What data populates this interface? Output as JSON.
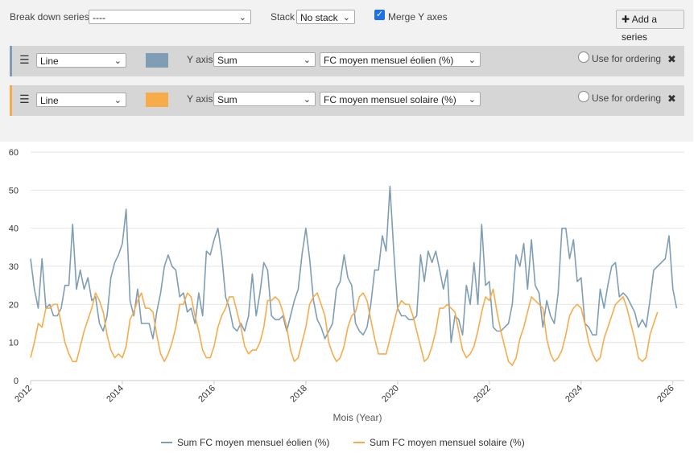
{
  "controls": {
    "breakdown_label": "Break down series",
    "breakdown_value": "----",
    "stack_label": "Stack",
    "stack_value": "No stack",
    "merge_label": "Merge Y axes",
    "add_series_label": "Add a series"
  },
  "series_rows": [
    {
      "type": "Line",
      "color": "#7f9db4",
      "yaxis_label": "Y axis",
      "agg": "Sum",
      "field": "FC moyen mensuel éolien (%)",
      "ordering_label": "Use for ordering"
    },
    {
      "type": "Line",
      "color": "#f7ac4c",
      "yaxis_label": "Y axis",
      "agg": "Sum",
      "field": "FC moyen mensuel solaire (%)",
      "ordering_label": "Use for ordering"
    }
  ],
  "chart_data": {
    "type": "line",
    "xlabel": "Mois (Year)",
    "ylabel": "",
    "x_ticks": [
      "2012",
      "2014",
      "2016",
      "2018",
      "2020",
      "2022",
      "2024",
      "2026"
    ],
    "y_ticks": [
      "0",
      "10",
      "20",
      "30",
      "40",
      "50",
      "60"
    ],
    "xlim": [
      2012,
      2026.25
    ],
    "ylim": [
      0,
      60
    ],
    "grid": true,
    "legend_position": "bottom",
    "series": [
      {
        "name": "Sum FC moyen mensuel éolien (%)",
        "color": "#7f9db4",
        "start": "2012-01",
        "step": "month",
        "values": [
          32,
          24,
          19,
          32,
          19,
          20,
          17,
          17,
          19,
          25,
          25,
          41,
          24,
          29,
          24,
          27,
          21,
          22,
          15,
          13,
          17,
          27,
          31,
          33,
          36,
          45,
          21,
          17,
          24,
          15,
          15,
          15,
          11,
          18,
          23,
          30,
          33,
          30,
          29,
          22,
          23,
          18,
          19,
          15,
          23,
          17,
          34,
          33,
          37,
          40,
          33,
          22,
          19,
          14,
          13,
          15,
          13,
          17,
          28,
          17,
          23,
          31,
          29,
          17,
          16,
          16,
          17,
          13,
          17,
          21,
          24,
          33,
          40,
          32,
          21,
          16,
          14,
          11,
          13,
          15,
          24,
          26,
          33,
          27,
          25,
          15,
          13,
          12,
          14,
          20,
          29,
          29,
          38,
          34,
          51,
          34,
          19,
          17,
          17,
          16,
          16,
          17,
          33,
          26,
          34,
          31,
          34,
          29,
          24,
          29,
          10,
          17,
          16,
          12,
          25,
          20,
          31,
          20,
          41,
          25,
          26,
          14,
          13,
          13,
          14,
          15,
          20,
          33,
          30,
          36,
          24,
          37,
          25,
          23,
          14,
          21,
          17,
          15,
          23,
          40,
          40,
          32,
          37,
          26,
          27,
          15,
          14,
          12,
          12,
          24,
          19,
          25,
          30,
          31,
          22,
          23,
          22,
          20,
          18,
          14,
          16,
          14,
          21,
          29,
          30,
          31,
          32,
          38,
          24,
          19
        ],
        "avg_values": []
      },
      {
        "name": "Sum FC moyen mensuel solaire (%)",
        "color": "#f7ac4c",
        "start": "2012-01",
        "step": "month",
        "values": [
          6,
          10,
          15,
          14,
          19,
          19,
          20,
          20,
          15,
          10,
          7,
          5,
          5,
          9,
          13,
          16,
          19,
          23,
          21,
          18,
          12,
          8,
          6,
          7,
          6,
          9,
          16,
          18,
          21,
          23,
          19,
          19,
          18,
          12,
          7,
          5,
          7,
          10,
          14,
          20,
          20,
          23,
          22,
          17,
          13,
          8,
          6,
          6,
          9,
          14,
          17,
          19,
          22,
          22,
          18,
          14,
          9,
          7,
          8,
          8,
          10,
          14,
          21,
          21,
          22,
          21,
          18,
          14,
          8,
          5,
          6,
          10,
          14,
          20,
          22,
          23,
          20,
          17,
          10,
          7,
          5,
          6,
          9,
          14,
          17,
          18,
          22,
          23,
          21,
          16,
          11,
          7,
          7,
          7,
          11,
          15,
          19,
          21,
          20,
          20,
          17,
          13,
          9,
          5,
          6,
          9,
          13,
          19,
          19,
          20,
          19,
          18,
          13,
          8,
          6,
          7,
          9,
          13,
          18,
          22,
          21,
          24,
          18,
          13,
          9,
          5,
          4,
          6,
          11,
          14,
          18,
          22,
          21,
          20,
          19,
          11,
          7,
          5,
          6,
          8,
          12,
          17,
          19,
          20,
          19,
          15,
          10,
          7,
          5,
          6,
          11,
          14,
          17,
          20,
          21,
          22,
          19,
          15,
          11,
          6,
          5,
          6,
          12,
          15,
          18
        ]
      }
    ],
    "legend": [
      {
        "label": "Sum FC moyen mensuel éolien (%)",
        "color": "#7f9db4"
      },
      {
        "label": "Sum FC moyen mensuel solaire (%)",
        "color": "#f7ac4c"
      }
    ]
  }
}
